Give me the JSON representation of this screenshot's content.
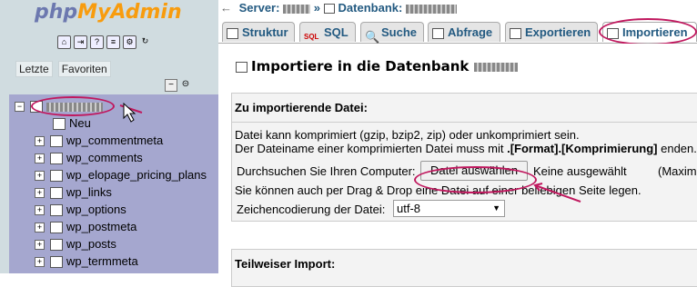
{
  "app": {
    "logo_php": "php",
    "logo_myadmin": "MyAdmin"
  },
  "sidebar": {
    "icons": [
      "home-icon",
      "exit-icon",
      "query-icon",
      "sql-help-icon",
      "settings-icon",
      "reload-icon"
    ],
    "recent_label": "Letzte",
    "favorites_label": "Favoriten",
    "tree": [
      {
        "label": "Neu"
      },
      {
        "label": "wp_commentmeta"
      },
      {
        "label": "wp_comments"
      },
      {
        "label": "wp_elopage_pricing_plans"
      },
      {
        "label": "wp_links"
      },
      {
        "label": "wp_options"
      },
      {
        "label": "wp_postmeta"
      },
      {
        "label": "wp_posts"
      },
      {
        "label": "wp_termmeta"
      }
    ],
    "highlight_color": "#c0185e"
  },
  "breadcrumb": {
    "server_label": "Server:",
    "db_label": "Datenbank:"
  },
  "tabs": [
    {
      "label": "Struktur"
    },
    {
      "label": "SQL"
    },
    {
      "label": "Suche"
    },
    {
      "label": "Abfrage"
    },
    {
      "label": "Exportieren"
    },
    {
      "label": "Importieren"
    }
  ],
  "main": {
    "title": "Importiere in die Datenbank",
    "file_section": {
      "legend": "Zu importierende Datei:",
      "line1": "Datei kann komprimiert (gzip, bzip2, zip) oder unkomprimiert sein.",
      "line2_prefix": "Der Dateiname einer komprimierten Datei muss mit ",
      "line2_bold": ".[Format].[Komprimierung]",
      "line2_suffix": " enden.",
      "browse_label": "Durchsuchen Sie Ihren Computer:",
      "file_button": "Datei auswählen",
      "no_file": "Keine ausgewählt",
      "max_note": "(Maxim",
      "drag_drop": "Sie können auch per Drag & Drop eine Datei auf einer beliebigen Seite legen.",
      "charset_label": "Zeichencodierung der Datei:",
      "charset_value": "utf-8"
    },
    "partial_legend": "Teilweiser Import:"
  }
}
